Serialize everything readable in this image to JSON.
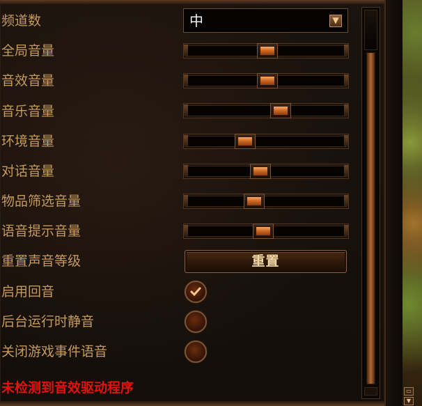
{
  "settings": {
    "channels_label": "频道数",
    "channels_value": "中",
    "sliders": [
      {
        "label": "全局音量",
        "level": 0.51
      },
      {
        "label": "音效音量",
        "level": 0.51
      },
      {
        "label": "音乐音量",
        "level": 0.61
      },
      {
        "label": "环境音量",
        "level": 0.34
      },
      {
        "label": "对话音量",
        "level": 0.46
      },
      {
        "label": "物品筛选音量",
        "level": 0.41
      },
      {
        "label": "语音提示音量",
        "level": 0.48
      }
    ],
    "reset_label": "重置声音等级",
    "reset_button": "重置",
    "toggles": [
      {
        "label": "启用回音",
        "checked": true
      },
      {
        "label": "后台运行时静音",
        "checked": false
      },
      {
        "label": "关闭游戏事件语音",
        "checked": false
      }
    ],
    "warning": "未检测到音效驱动程序"
  },
  "colors": {
    "label": "#c49a5d",
    "warning": "#e2120d",
    "accent": "#d06a24"
  },
  "icons": {
    "dropdown": "chevron-down-icon",
    "check": "checkmark-icon"
  }
}
